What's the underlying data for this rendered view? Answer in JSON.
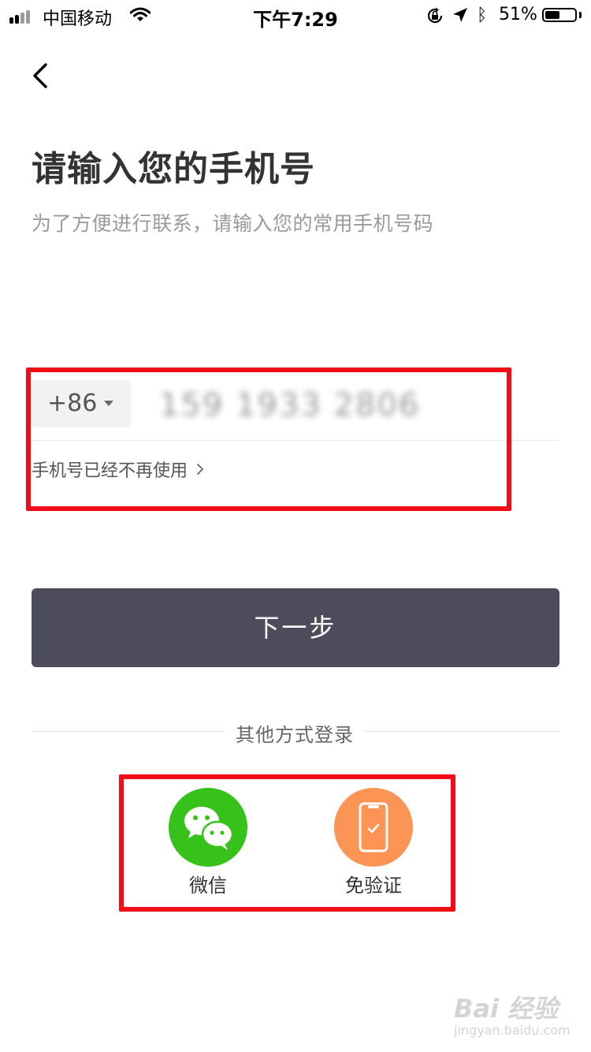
{
  "status_bar": {
    "carrier": "中国移动",
    "time": "下午7:29",
    "battery_percent": "51%",
    "battery_level": 0.51,
    "icons": [
      "signal-icon",
      "wifi-icon",
      "rotation-lock-icon",
      "location-icon",
      "bluetooth-icon",
      "battery-icon"
    ]
  },
  "header": {
    "back_icon": "chevron-left-icon",
    "title": "请输入您的手机号",
    "subtitle": "为了方便进行联系，请输入您的常用手机号码"
  },
  "phone_form": {
    "country_code": "+86",
    "phone_value": "159 1933 2806",
    "no_longer_used_label": "手机号已经不再使用"
  },
  "next_button": {
    "label": "下一步",
    "color": "#4d4c5c"
  },
  "other_login": {
    "label": "其他方式登录",
    "options": [
      {
        "label": "微信",
        "icon": "wechat-icon",
        "color": "#36c21a"
      },
      {
        "label": "免验证",
        "icon": "phone-check-icon",
        "color": "#fc9456"
      }
    ]
  },
  "annotation_color": "#f20c18",
  "watermark": {
    "logo": "Bai 经验",
    "url": "jingyan.baidu.com"
  }
}
